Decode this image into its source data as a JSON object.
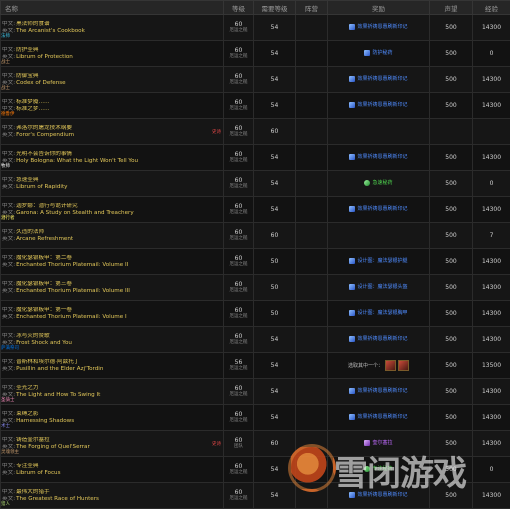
{
  "headers": [
    "名称",
    "等级",
    "需要等级",
    "阵营",
    "奖励",
    "声望",
    "经验"
  ],
  "rows": [
    {
      "cn": "黑法师的食谱",
      "en": "The Arcanist's Cookbook",
      "cls": "法师",
      "cls_color": "#3fc7eb",
      "badge": "",
      "level": "60",
      "level_sub": "厄运之槌",
      "req": "54",
      "faction": "",
      "reward": "效果祈祷恩惠刷新印记",
      "reward_type": "blue",
      "rep": "500",
      "xp": "14300"
    },
    {
      "cn": "防护圣典",
      "en": "Librum of Protection",
      "cls": "战士",
      "cls_color": "#c69b6d",
      "badge": "",
      "level": "60",
      "level_sub": "厄运之槌",
      "req": "54",
      "faction": "",
      "reward": "防护秘药",
      "reward_type": "blue",
      "rep": "500",
      "xp": "0"
    },
    {
      "cn": "防御宝典",
      "en": "Codex of Defense",
      "cls": "战士",
      "cls_color": "#c69b6d",
      "badge": "",
      "level": "60",
      "level_sub": "厄运之槌",
      "req": "54",
      "faction": "",
      "reward": "效果祈祷恩惠刷新印记",
      "reward_type": "blue",
      "rep": "500",
      "xp": "14300"
    },
    {
      "cn": "标准梦魇……",
      "cn2": "标准之梦……",
      "en": "",
      "cls": "德鲁伊",
      "cls_color": "#ff7c0a",
      "badge": "",
      "level": "60",
      "level_sub": "厄运之槌",
      "req": "54",
      "faction": "",
      "reward": "效果祈祷恩惠刷新印记",
      "reward_type": "blue",
      "rep": "500",
      "xp": "14300"
    },
    {
      "cn": "弗洛尔的屠龙技术纲要",
      "en": "Foror's Compendium",
      "cls": "",
      "cls_color": "#c69b6d",
      "badge": "史诗",
      "level": "60",
      "level_sub": "厄运之槌",
      "req": "60",
      "faction": "",
      "reward": "",
      "reward_type": "",
      "rep": "",
      "xp": ""
    },
    {
      "cn": "光明不会告诉你的事情",
      "en": "Holy Bologna:  What the Light Won't Tell You",
      "cls": "牧师",
      "cls_color": "#ffffff",
      "badge": "",
      "level": "60",
      "level_sub": "厄运之槌",
      "req": "54",
      "faction": "",
      "reward": "效果祈祷恩惠刷新印记",
      "reward_type": "blue",
      "rep": "500",
      "xp": "14300"
    },
    {
      "cn": "急速圣典",
      "en": "Librum of Rapidity",
      "cls": "",
      "cls_color": "#c69b6d",
      "badge": "",
      "level": "60",
      "level_sub": "厄运之槌",
      "req": "54",
      "faction": "",
      "reward": "急速秘药",
      "reward_type": "green",
      "rep": "500",
      "xp": "0"
    },
    {
      "cn": "迦罗娜：潜行与诡计研究",
      "en": "Garona:  A Study on Stealth and Treachery",
      "cls": "潜行者",
      "cls_color": "#fff468",
      "badge": "",
      "level": "60",
      "level_sub": "厄运之槌",
      "req": "54",
      "faction": "",
      "reward": "效果祈祷恩惠刷新印记",
      "reward_type": "blue",
      "rep": "500",
      "xp": "14300"
    },
    {
      "cn": "久违的法师",
      "en": "Arcane Refreshment",
      "cls": "",
      "cls_color": "#3fc7eb",
      "badge": "",
      "level": "60",
      "level_sub": "厄运之槌",
      "req": "60",
      "faction": "",
      "reward": "",
      "reward_type": "",
      "rep": "500",
      "xp": "7"
    },
    {
      "cn": "魔化瑟银板甲：第二卷",
      "en": "Enchanted Thorium Platemail:  Volume II",
      "cls": "",
      "cls_color": "#c69b6d",
      "badge": "",
      "level": "60",
      "level_sub": "厄运之槌",
      "req": "50",
      "faction": "",
      "reward": "设计图：魔法瑟银护腿",
      "reward_type": "blue",
      "rep": "500",
      "xp": "14300"
    },
    {
      "cn": "魔化瑟银板甲：第三卷",
      "en": "Enchanted Thorium Platemail:  Volume III",
      "cls": "",
      "cls_color": "#c69b6d",
      "badge": "",
      "level": "60",
      "level_sub": "厄运之槌",
      "req": "50",
      "faction": "",
      "reward": "设计图：魔法瑟银头盔",
      "reward_type": "blue",
      "rep": "500",
      "xp": "14300"
    },
    {
      "cn": "魔化瑟银板甲：第一卷",
      "en": "Enchanted Thorium Platemail:  Volume I",
      "cls": "",
      "cls_color": "#c69b6d",
      "badge": "",
      "level": "60",
      "level_sub": "厄运之槌",
      "req": "50",
      "faction": "",
      "reward": "设计图：魔法瑟银胸甲",
      "reward_type": "blue",
      "rep": "500",
      "xp": "14300"
    },
    {
      "cn": "冰与火的赞歌",
      "en": "Frost Shock and You",
      "cls": "萨满祭司",
      "cls_color": "#0070dd",
      "badge": "",
      "level": "60",
      "level_sub": "厄运之槌",
      "req": "54",
      "faction": "",
      "reward": "效果祈祷恩惠刷新印记",
      "reward_type": "blue",
      "rep": "500",
      "xp": "14300"
    },
    {
      "cn": "普斯林和埃尔德·阿兹托丁",
      "en": "Pusillin and the Elder Azj'Tordin",
      "cls": "",
      "cls_color": "#c69b6d",
      "badge": "",
      "level": "56",
      "level_sub": "厄运之槌",
      "req": "54",
      "faction": "",
      "reward": "选取其中一个：",
      "reward_type": "mixed",
      "rep": "500",
      "xp": "13500"
    },
    {
      "cn": "圣光之力",
      "en": "The Light and How To Swing It",
      "cls": "圣骑士",
      "cls_color": "#f48cba",
      "badge": "",
      "level": "60",
      "level_sub": "厄运之槌",
      "req": "54",
      "faction": "",
      "reward": "效果祈祷恩惠刷新印记",
      "reward_type": "blue",
      "rep": "500",
      "xp": "14300"
    },
    {
      "cn": "束缚之影",
      "en": "Harnessing Shadows",
      "cls": "术士",
      "cls_color": "#8788ee",
      "badge": "",
      "level": "60",
      "level_sub": "厄运之槌",
      "req": "54",
      "faction": "",
      "reward": "效果祈祷恩惠刷新印记",
      "reward_type": "blue",
      "rep": "500",
      "xp": "14300"
    },
    {
      "cn": "铸造奎尔塞拉",
      "en": "The Forging of Quel'Serrar",
      "cls": "灵魂领主",
      "cls_color": "#c69b6d",
      "badge": "史诗",
      "level": "60",
      "level_sub": "团队",
      "req": "60",
      "faction": "",
      "reward": "奎尔塞拉",
      "reward_type": "purple",
      "rep": "500",
      "xp": "14300"
    },
    {
      "cn": "专注圣典",
      "en": "Librum of Focus",
      "cls": "",
      "cls_color": "#c69b6d",
      "badge": "",
      "level": "60",
      "level_sub": "厄运之槌",
      "req": "54",
      "faction": "",
      "reward": "专注秘药",
      "reward_type": "green",
      "rep": "500",
      "xp": "0"
    },
    {
      "cn": "最伟大的猎手",
      "en": "The Greatest Race of Hunters",
      "cls": "猎人",
      "cls_color": "#aad372",
      "badge": "",
      "level": "60",
      "level_sub": "厄运之槌",
      "req": "54",
      "faction": "",
      "reward": "效果祈祷恩惠刷新印记",
      "reward_type": "blue",
      "rep": "500",
      "xp": "14300"
    }
  ],
  "prefix": {
    "cn": "中文:",
    "en": "英文:"
  },
  "watermark": "雪闭游戏"
}
